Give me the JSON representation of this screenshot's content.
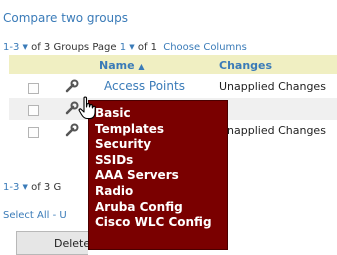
{
  "title": "Compare two groups",
  "pager": {
    "range": "1-3",
    "of_groups": "of 3 Groups",
    "page_label": "Page",
    "page": "1",
    "of_pages": "of 1",
    "choose_columns": "Choose Columns"
  },
  "table": {
    "columns": [
      "Name",
      "Changes"
    ],
    "sort_indicator": "▲",
    "rows": [
      {
        "name": "Access Points",
        "changes": "Unapplied Changes"
      },
      {
        "name": "",
        "changes": ""
      },
      {
        "name": "",
        "changes": "Unapplied Changes"
      }
    ]
  },
  "bottom_pager": {
    "range": "1-3",
    "text": "of 3 G"
  },
  "select_links": "Select All - U",
  "delete_label": "Delete",
  "menu": {
    "items": [
      "Basic",
      "Templates",
      "Security",
      "SSIDs",
      "AAA Servers",
      "Radio",
      "Aruba Config",
      "Cisco WLC Config"
    ]
  },
  "icons": {
    "row_action": "wrench-icon",
    "cursor": "hand-pointer-icon"
  },
  "colors": {
    "link": "#3a7bb8",
    "header_bg": "#f0efc2",
    "menu_bg": "#7a0000"
  }
}
